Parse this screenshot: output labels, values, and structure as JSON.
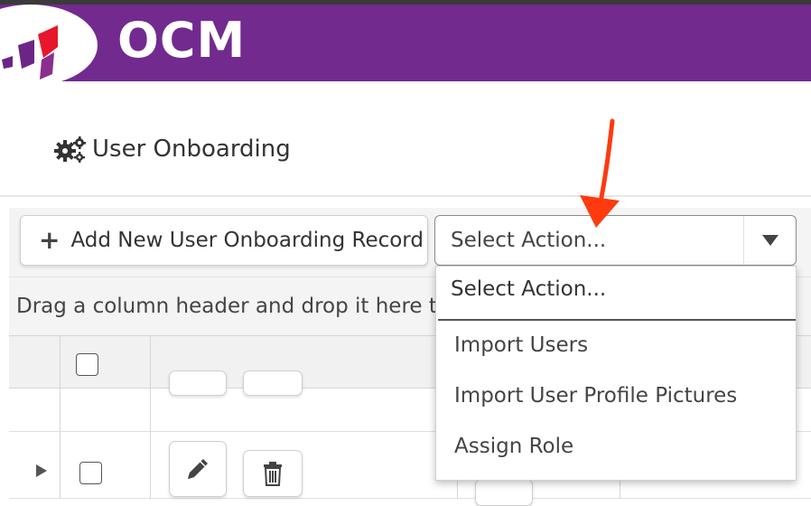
{
  "header": {
    "brand": "OCM",
    "colors": {
      "brand_bar": "#722a8e",
      "logo_red": "#e8162a",
      "logo_purple": "#6b2587"
    }
  },
  "page": {
    "title": "User Onboarding",
    "title_icon": "gears-icon"
  },
  "toolbar": {
    "add_button_label": "Add New User Onboarding Record",
    "add_button_icon": "plus-icon",
    "action_select": {
      "selected": "Select Action...",
      "arrow_icon": "caret-down-icon",
      "options": [
        "Select Action...",
        "Import Users",
        "Import User Profile Pictures",
        "Assign Role"
      ]
    }
  },
  "grid": {
    "group_panel_text": "Drag a column header and drop it here to g",
    "row_actions": {
      "edit_icon": "pencil-icon",
      "delete_icon": "trash-icon",
      "expand_icon": "caret-right-icon"
    }
  },
  "annotation": {
    "arrow_color": "#ff3a0f"
  }
}
